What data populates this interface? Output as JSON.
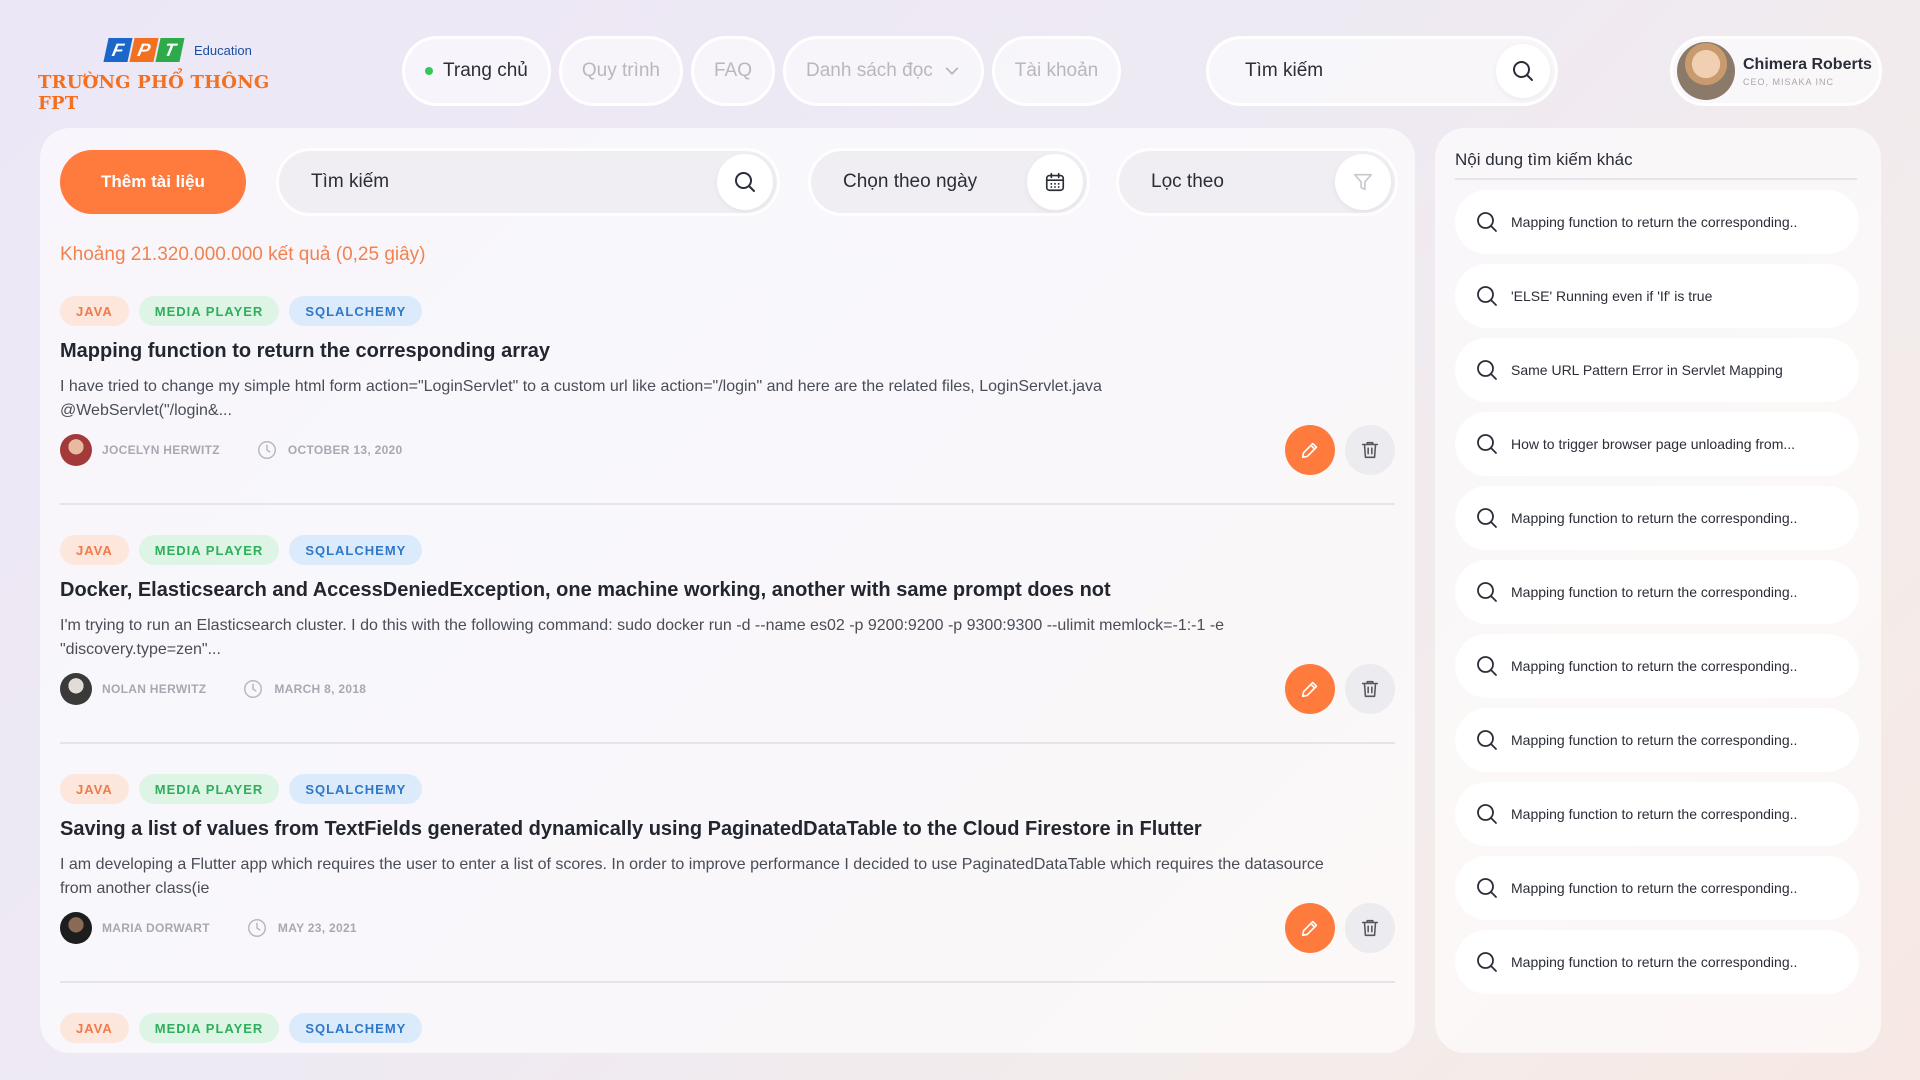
{
  "logo": {
    "letters": [
      "F",
      "P",
      "T"
    ],
    "edu_label": "Education",
    "school_name": "TRƯỜNG PHỔ THÔNG FPT"
  },
  "nav": {
    "items": [
      {
        "label": "Trang chủ",
        "active": true
      },
      {
        "label": "Quy trình",
        "active": false
      },
      {
        "label": "FAQ",
        "active": false
      },
      {
        "label": "Danh sách đọc",
        "active": false,
        "has_dropdown": true
      },
      {
        "label": "Tài khoản",
        "active": false
      }
    ]
  },
  "top_search": {
    "placeholder": "Tìm kiếm",
    "icon": "search-icon"
  },
  "profile": {
    "name": "Chimera Roberts",
    "role": "CEO, MISAKA INC"
  },
  "toolbar": {
    "add_label": "Thêm tài liệu",
    "search_placeholder": "Tìm kiếm",
    "date_placeholder": "Chọn theo ngày",
    "filter_placeholder": "Lọc theo"
  },
  "results": {
    "count_text": "Khoảng 21.320.000.000 kết quả (0,25 giây)",
    "items": [
      {
        "tags": [
          "JAVA",
          "MEDIA PLAYER",
          "SQLALCHEMY"
        ],
        "title": "Mapping function to return the corresponding array",
        "desc_line1": "I have tried to change my simple html form action=\"LoginServlet\" to a custom url like action=\"/login\" and here are the related files, LoginServlet.java",
        "desc_line2": "@WebServlet(\"/login&...",
        "author": "JOCELYN HERWITZ",
        "date": "OCTOBER 13, 2020"
      },
      {
        "tags": [
          "JAVA",
          "MEDIA PLAYER",
          "SQLALCHEMY"
        ],
        "title": "Docker, Elasticsearch and AccessDeniedException, one machine working, another with same prompt does not",
        "desc_line1": "I'm trying to run an Elasticsearch cluster. I do this with the following command: sudo docker run -d --name es02 -p 9200:9200 -p 9300:9300 --ulimit memlock=-1:-1 -e",
        "desc_line2": "\"discovery.type=zen\"...",
        "author": "NOLAN HERWITZ",
        "date": "MARCH 8, 2018"
      },
      {
        "tags": [
          "JAVA",
          "MEDIA PLAYER",
          "SQLALCHEMY"
        ],
        "title": "Saving a list of values from TextFields generated dynamically using PaginatedDataTable to the Cloud Firestore in Flutter",
        "desc_line1": "I am developing a Flutter app which requires the user to enter a list of scores. In order to improve performance I decided to use PaginatedDataTable which requires the datasource",
        "desc_line2": "from another class(ie",
        "author": "MARIA DORWART",
        "date": "MAY 23, 2021"
      },
      {
        "tags": [
          "JAVA",
          "MEDIA PLAYER",
          "SQLALCHEMY"
        ]
      }
    ]
  },
  "side": {
    "title": "Nội dung tìm kiếm khác",
    "items": [
      "Mapping function to return the corresponding..",
      "'ELSE' Running even if 'If' is true",
      "Same URL Pattern Error in Servlet Mapping",
      "How to trigger browser page unloading from...",
      "Mapping function to return the corresponding..",
      "Mapping function to return the corresponding..",
      "Mapping function to return the corresponding..",
      "Mapping function to return the corresponding..",
      "Mapping function to return the corresponding..",
      "Mapping function to return the corresponding..",
      "Mapping function to return the corresponding.."
    ]
  },
  "colors": {
    "accent": "#ff7b3d",
    "active_dot": "#34c759"
  }
}
